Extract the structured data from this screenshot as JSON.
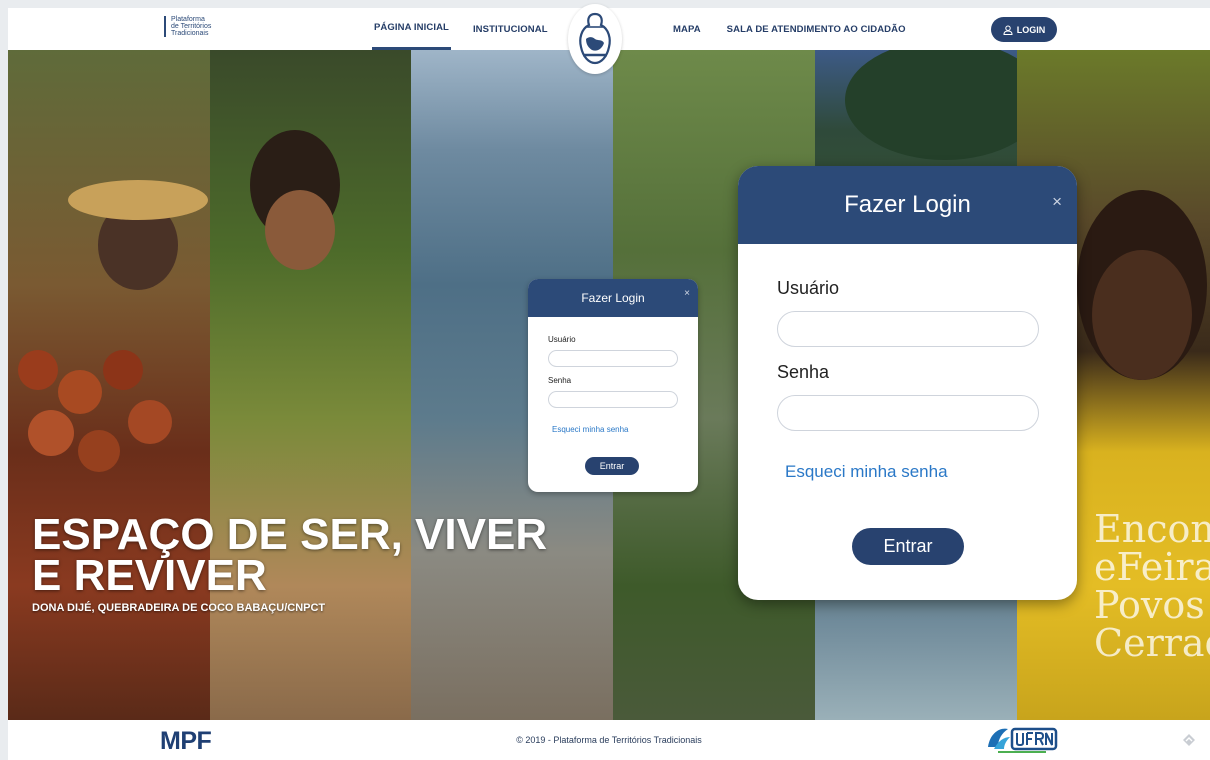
{
  "header": {
    "brand_lines": [
      "Plataforma",
      "de Territórios",
      "Tradicionais"
    ],
    "nav": {
      "home": "PÁGINA INICIAL",
      "institutional": "INSTITUCIONAL",
      "map": "MAPA",
      "service_room": "SALA DE ATENDIMENTO AO CIDADÃO"
    },
    "login_label": "LOGIN",
    "login_icon": "user-icon"
  },
  "hero": {
    "title_line1": "ESPAÇO DE SER, VIVER",
    "title_line2": "E REVIVER",
    "subtitle": "DONA DIJÉ, QUEBRADEIRA DE COCO BABAÇU/CNPCT",
    "poster_text": [
      "Encontr",
      "eFeira",
      "Povos",
      "Cerrad"
    ]
  },
  "login_modal_small": {
    "title": "Fazer Login",
    "close": "×",
    "user_label": "Usuário",
    "user_value": "",
    "password_label": "Senha",
    "password_value": "",
    "forgot_link": "Esqueci minha senha",
    "submit": "Entrar"
  },
  "login_modal_large": {
    "title": "Fazer Login",
    "close": "×",
    "user_label": "Usuário",
    "user_value": "",
    "password_label": "Senha",
    "password_value": "",
    "forgot_link": "Esqueci minha senha",
    "submit": "Entrar"
  },
  "footer": {
    "mpf": "MPF",
    "copyright": "© 2019 - Plataforma de Territórios Tradicionais"
  },
  "colors": {
    "primary": "#2c4a78",
    "button": "#28426f",
    "link": "#2a78c7"
  }
}
